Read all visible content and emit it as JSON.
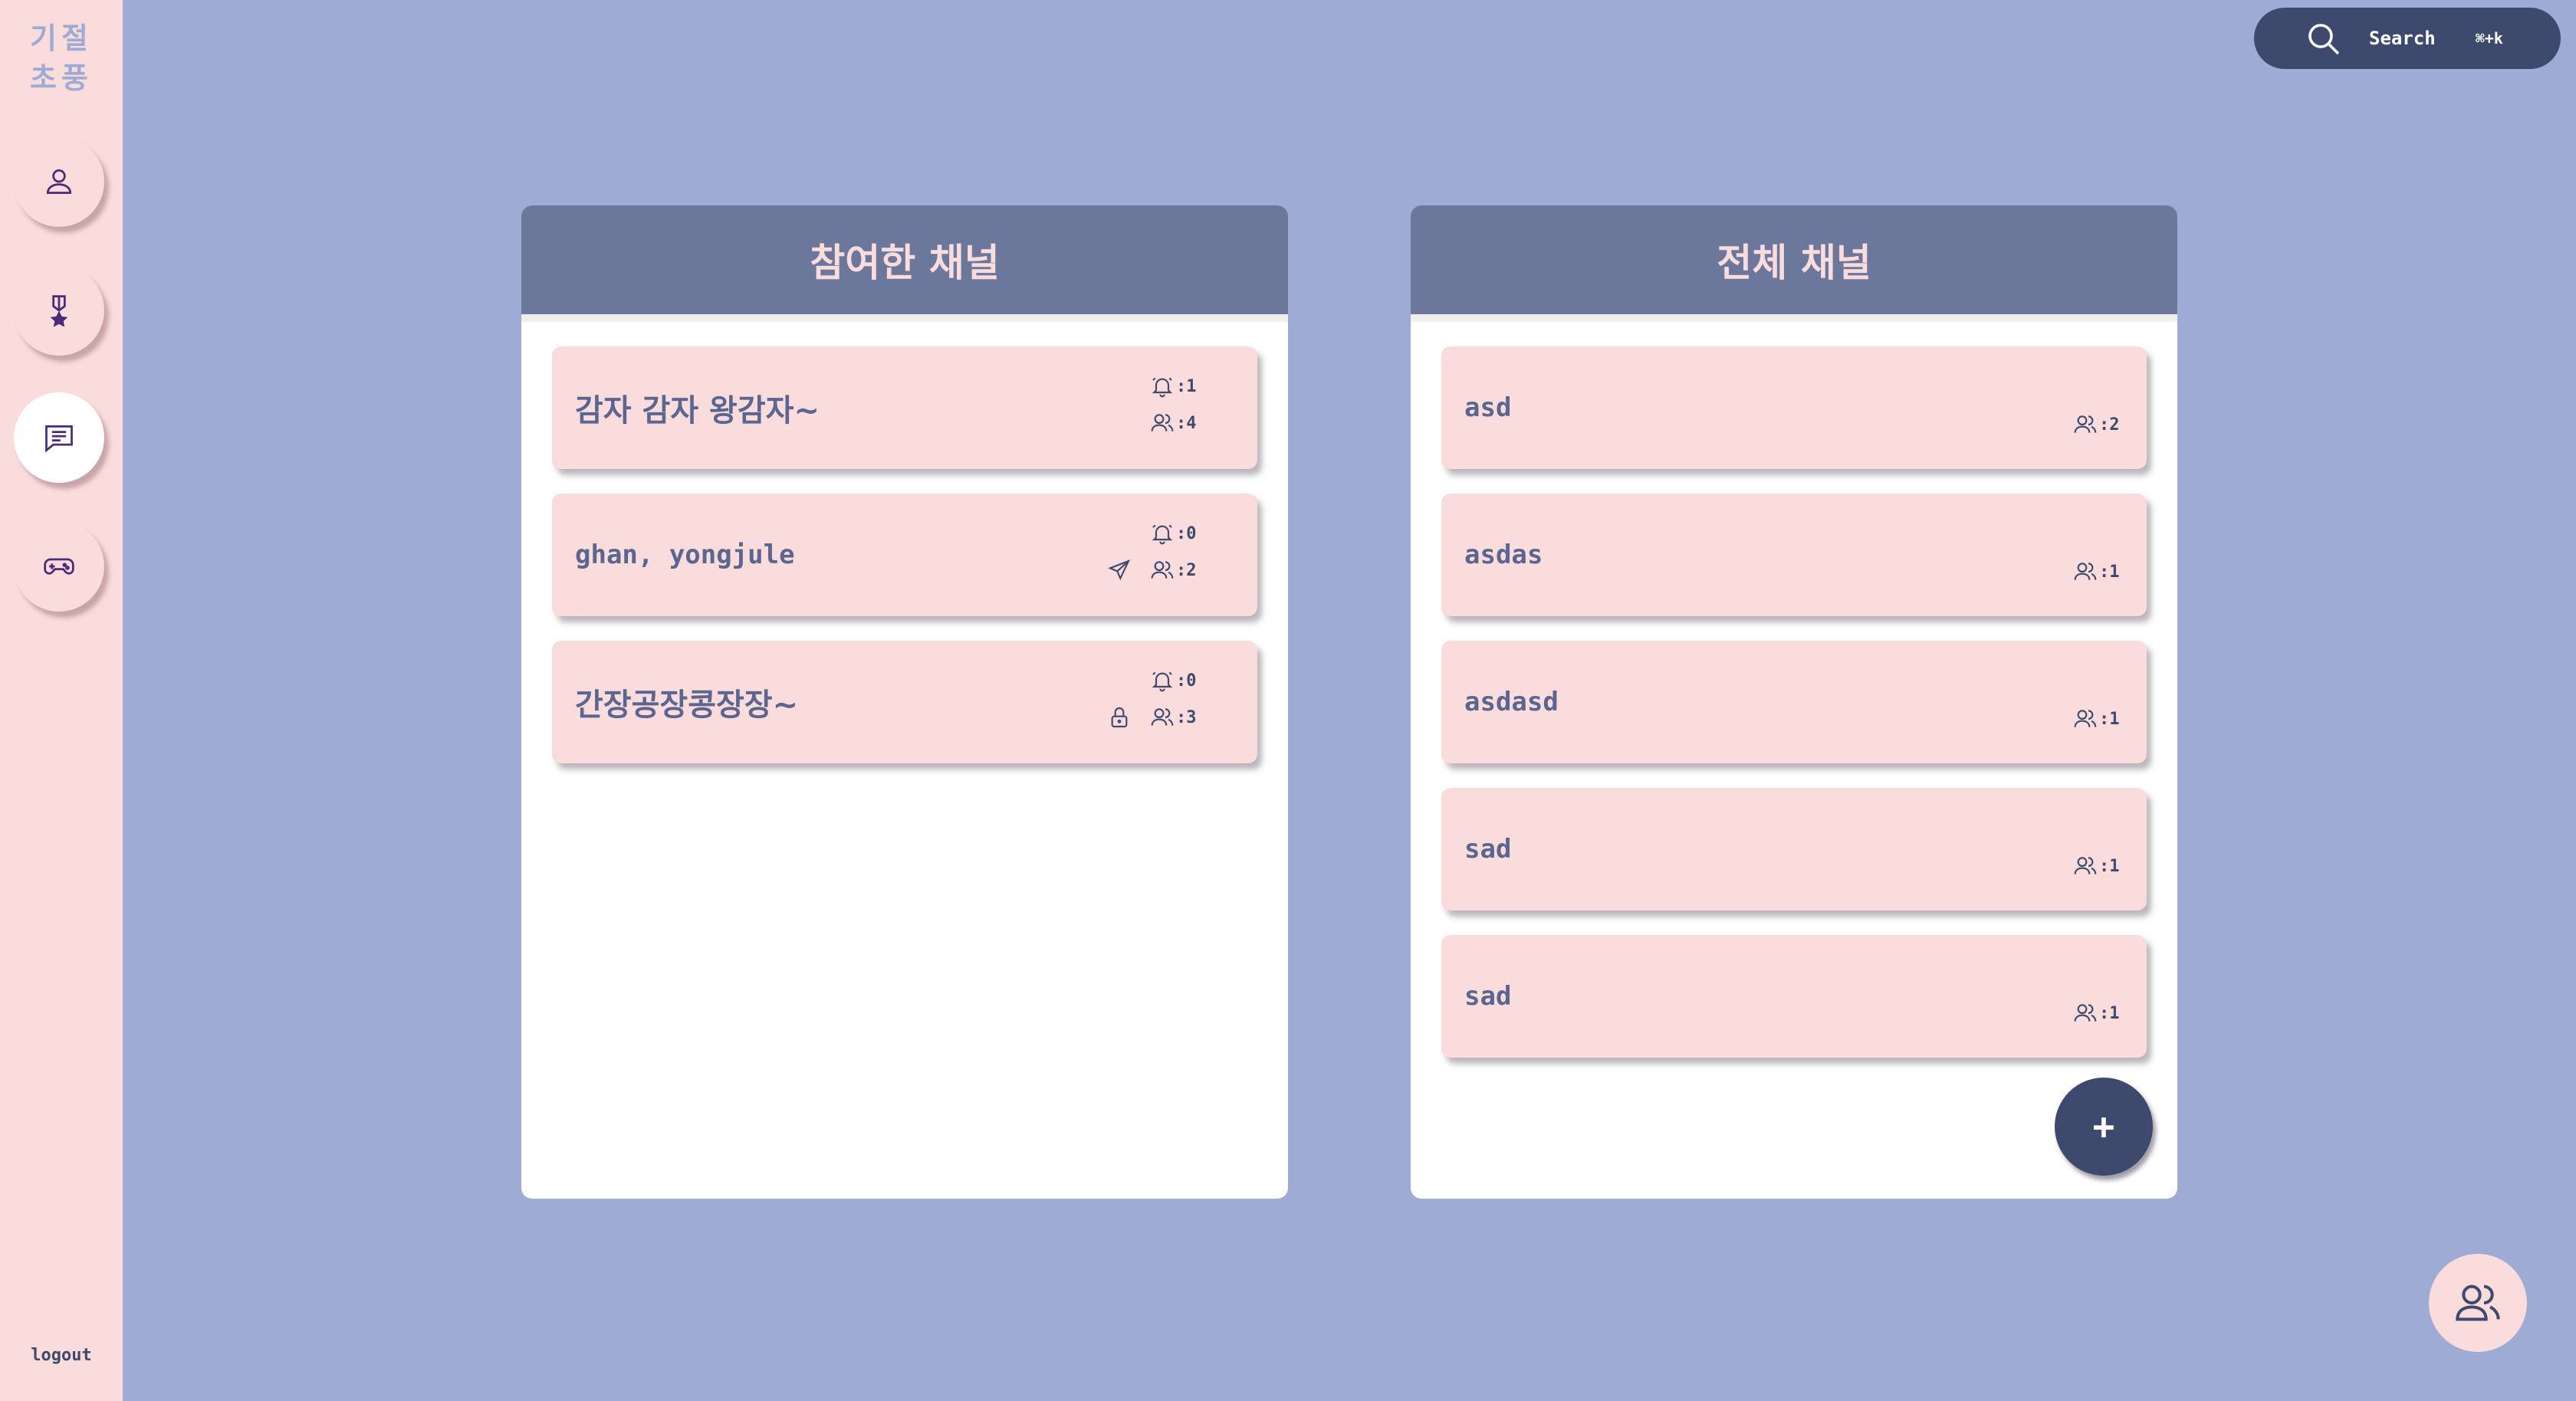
{
  "sidebar": {
    "logo_line1": "기절",
    "logo_line2": "초풍",
    "nav": [
      {
        "icon": "user-icon"
      },
      {
        "icon": "medal-icon"
      },
      {
        "icon": "chat-icon",
        "active": true
      },
      {
        "icon": "gamepad-icon"
      }
    ],
    "logout_label": "logout"
  },
  "search": {
    "label": "Search",
    "shortcut": "⌘+k"
  },
  "joined_panel": {
    "title": "참여한 채널",
    "channels": [
      {
        "name": "감자 감자 왕감자~",
        "unread": ":1",
        "members": ":4",
        "badge": null
      },
      {
        "name": "ghan, yongjule",
        "unread": ":0",
        "members": ":2",
        "badge": "send-icon"
      },
      {
        "name": "간장공장콩장장~",
        "unread": ":0",
        "members": ":3",
        "badge": "lock-icon"
      }
    ]
  },
  "all_panel": {
    "title": "전체 채널",
    "channels": [
      {
        "name": "asd",
        "members": ":2"
      },
      {
        "name": "asdas",
        "members": ":1"
      },
      {
        "name": "asdasd",
        "members": ":1"
      },
      {
        "name": "sad",
        "members": ":1"
      },
      {
        "name": "sad",
        "members": ":1"
      }
    ],
    "add_label": "+"
  },
  "colors": {
    "background": "#9eabd4",
    "sidebar": "#fadcdc",
    "header": "#6b789c",
    "accent": "#3d4a6e",
    "card": "#fadcdc"
  }
}
